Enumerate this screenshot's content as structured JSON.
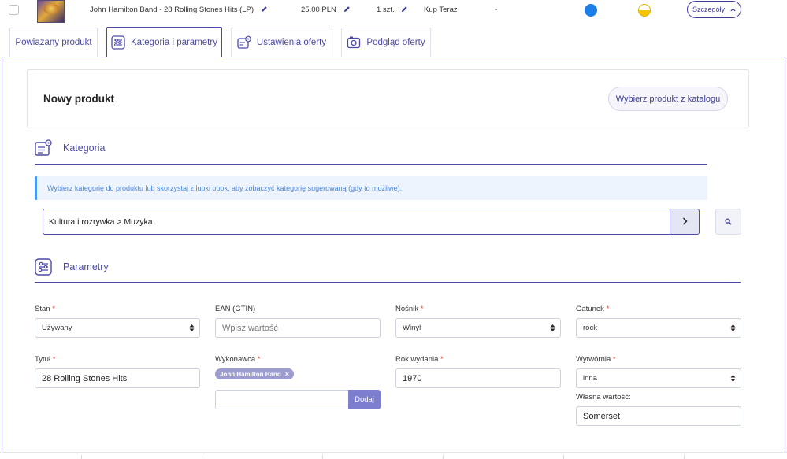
{
  "product_row": {
    "name": "John Hamilton Band - 28 Rolling Stones Hits (LP)",
    "price": "25.00 PLN",
    "quantity": "1 szt.",
    "offer_type": "Kup Teraz",
    "extra": "-",
    "details_label": "Szczegóły",
    "colors": {
      "status_blue": "#1e7ee8",
      "status_yellow": "#f5c400"
    }
  },
  "tabs": [
    {
      "label": "Powiązany produkt",
      "active": false
    },
    {
      "label": "Kategoria i parametry",
      "active": true,
      "icon": "sliders-icon"
    },
    {
      "label": "Ustawienia oferty",
      "active": false,
      "icon": "settings-card-icon"
    },
    {
      "label": "Podgląd oferty",
      "active": false,
      "icon": "camera-icon"
    }
  ],
  "new_product": {
    "title": "Nowy produkt",
    "catalog_button": "Wybierz produkt z katalogu"
  },
  "category": {
    "heading": "Kategoria",
    "info": "Wybierz kategorię do produktu lub skorzystaj z lupki obok, aby zobaczyć kategorię sugerowaną (gdy to możliwe).",
    "path": "Kultura i rozrywka > Muzyka"
  },
  "parameters": {
    "heading": "Parametry",
    "stan": {
      "label": "Stan",
      "required": "*",
      "value": "Używany"
    },
    "ean": {
      "label": "EAN (GTIN)",
      "placeholder": "Wpisz wartość"
    },
    "nosnik": {
      "label": "Nośnik",
      "required": "*",
      "value": "Winyl"
    },
    "gatunek": {
      "label": "Gatunek",
      "required": "*",
      "value": "rock"
    },
    "tytul": {
      "label": "Tytuł",
      "required": "*",
      "value": "28 Rolling Stones Hits"
    },
    "wykonawca": {
      "label": "Wykonawca",
      "required": "*",
      "chip": "John Hamilton Band",
      "chip_remove": "×",
      "add_label": "Dodaj",
      "input_value": ""
    },
    "rok": {
      "label": "Rok wydania",
      "required": "*",
      "value": "1970"
    },
    "wytwornia": {
      "label": "Wytwórnia",
      "required": "*",
      "value": "inna"
    },
    "wlasna": {
      "label": "Własna wartość:",
      "value": "Somerset"
    }
  },
  "accent_color": "#4b4aa8"
}
